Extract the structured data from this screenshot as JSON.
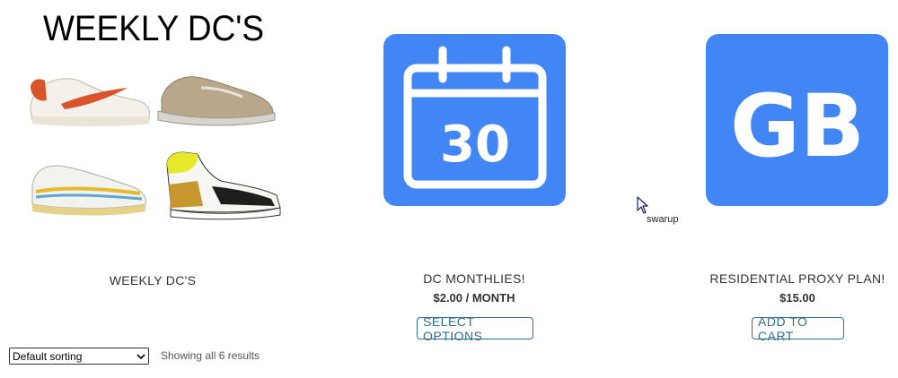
{
  "products": [
    {
      "image_heading": "WEEKLY DC'S",
      "title": "WEEKLY DC'S",
      "price": "",
      "button_label": ""
    },
    {
      "image_number": "30",
      "title": "DC MONTHLIES!",
      "price": "$2.00 / MONTH",
      "button_label": "SELECT OPTIONS"
    },
    {
      "image_letters": "GB",
      "title": "RESIDENTIAL PROXY PLAN!",
      "price": "$15.00",
      "button_label": "ADD TO CART"
    }
  ],
  "toolbar": {
    "sorting_selected": "Default sorting",
    "result_count": "Showing all 6 results"
  },
  "cursor_tooltip": "swarup",
  "colors": {
    "tile_blue": "#4285f4",
    "button_blue": "#2f6f8f",
    "text_dark": "#333333"
  },
  "icons": {
    "calendar": "calendar-icon",
    "cursor": "mouse-pointer-icon",
    "select_arrow": "chevron-down-icon"
  }
}
